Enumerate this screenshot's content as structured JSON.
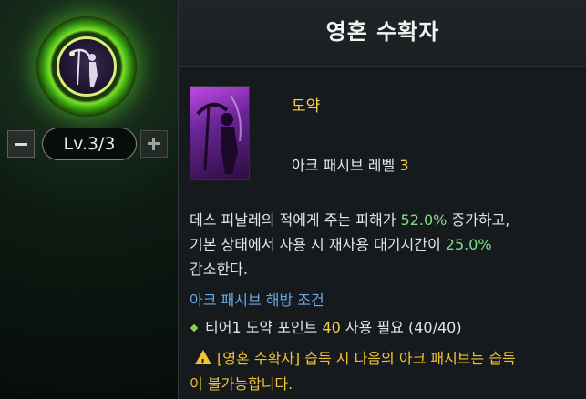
{
  "skill_node": {
    "level_label": "Lv.3/3",
    "decrease_icon": "minus-icon",
    "increase_icon": "plus-icon"
  },
  "tooltip": {
    "title": "영혼 수확자",
    "category": "도약",
    "passive_level_label": "아크 패시브 레벨",
    "passive_level_value": "3",
    "description": {
      "line1_pre": "데스 피날레의 적에게 주는 피해가 ",
      "line1_value": "52.0%",
      "line1_post": " 증가하고,",
      "line2_pre": "기본 상태에서 사용 시 재사용 대기시간이 ",
      "line2_value": "25.0%",
      "line3": "감소한다."
    },
    "unlock_condition_title": "아크 패시브 해방 조건",
    "condition": {
      "pre": "티어1 도약 포인트 ",
      "value": "40",
      "post": " 사용 필요 (40/40)"
    },
    "warning": {
      "line1": "[영혼 수확자] 습득 시 다음의 아크 패시브는 습득",
      "line2": "이 불가능합니다."
    }
  },
  "colors": {
    "accent_yellow": "#f3d24a",
    "highlight_green": "#7fe08b",
    "condition_blue": "#6aa9e6",
    "ring_green": "#7be02a"
  }
}
